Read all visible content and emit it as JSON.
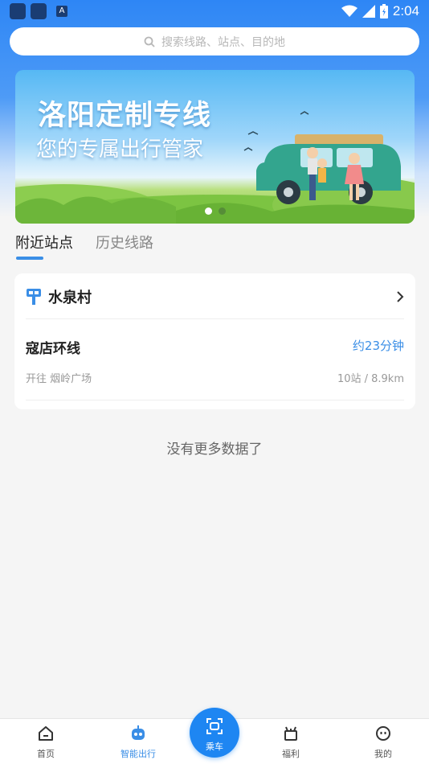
{
  "status_bar": {
    "time": "2:04"
  },
  "search": {
    "placeholder": "搜索线路、站点、目的地"
  },
  "banner": {
    "title": "洛阳定制专线",
    "subtitle": "您的专属出行管家"
  },
  "tabs": [
    {
      "label": "附近站点",
      "active": true
    },
    {
      "label": "历史线路",
      "active": false
    }
  ],
  "stop": {
    "name": "水泉村"
  },
  "route": {
    "name": "寇店环线",
    "eta": "约23分钟",
    "direction": "开往 烟岭广场",
    "meta": "10站 / 8.9km"
  },
  "no_more_text": "没有更多数据了",
  "bottom_nav": {
    "home": "首页",
    "smart_travel": "智能出行",
    "ride": "乘车",
    "welfare": "福利",
    "mine": "我的"
  },
  "colors": {
    "accent": "#3a8ee6",
    "primary_button": "#1e86f2"
  }
}
